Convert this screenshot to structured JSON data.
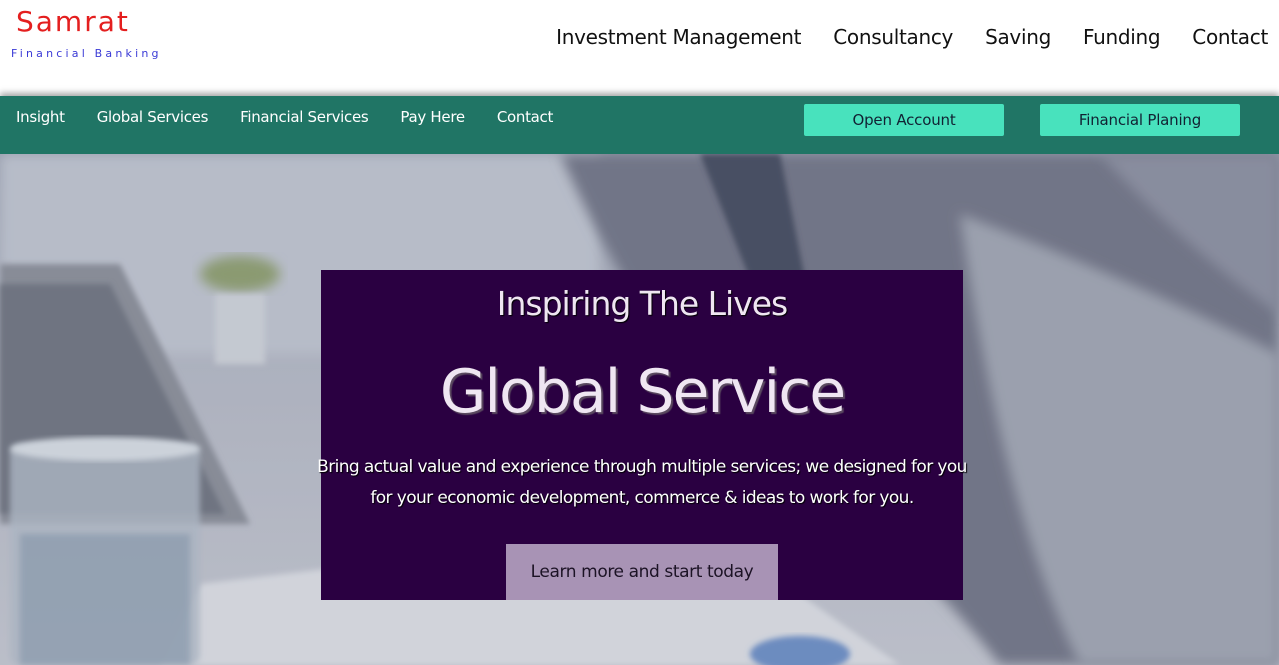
{
  "brand": {
    "name": "Samrat",
    "tagline": "Financial Banking"
  },
  "main_nav": [
    {
      "label": "Investment Management"
    },
    {
      "label": "Consultancy"
    },
    {
      "label": "Saving"
    },
    {
      "label": "Funding"
    },
    {
      "label": "Contact"
    }
  ],
  "sub_nav": [
    {
      "label": "Insight"
    },
    {
      "label": "Global Services"
    },
    {
      "label": "Financial Services"
    },
    {
      "label": "Pay Here"
    },
    {
      "label": "Contact"
    }
  ],
  "buttons": {
    "open_account": "Open Account",
    "financial_planing": "Financial Planing"
  },
  "hero": {
    "kicker": "Inspiring The Lives",
    "title": "Global Service",
    "description": "Bring actual value and experience through multiple services; we designed for you for your economic development, commerce & ideas to work for you.",
    "cta": "Learn more and start today"
  },
  "colors": {
    "brand_red": "#e41f1f",
    "tagline_blue": "#3a3ad6",
    "sub_bar": "#207565",
    "cta_green": "#48e2bd",
    "hero_card": "#2a0041",
    "hero_button": "#a893b5"
  }
}
